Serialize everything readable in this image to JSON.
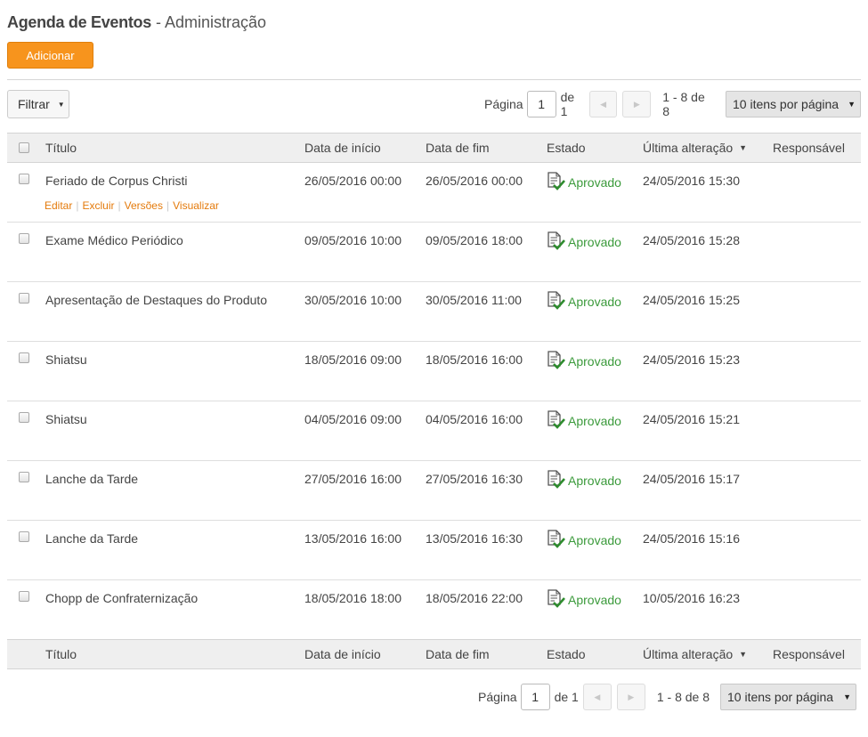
{
  "page": {
    "title": "Agenda de Eventos",
    "separator": "-",
    "subtitle": "Administração"
  },
  "toolbar": {
    "add_label": "Adicionar",
    "filter_label": "Filtrar"
  },
  "pager": {
    "page_label": "Página",
    "current_page": "1",
    "of_label": "de 1",
    "range": "1 - 8 de 8",
    "per_page": "10 itens por página",
    "prev_icon": "chevron-left-icon",
    "next_icon": "chevron-right-icon"
  },
  "columns": {
    "title": "Título",
    "start": "Data de início",
    "end": "Data de fim",
    "status": "Estado",
    "modified": "Última alteração",
    "owner": "Responsável"
  },
  "row_actions": {
    "edit": "Editar",
    "delete": "Excluir",
    "versions": "Versões",
    "view": "Visualizar"
  },
  "rows": [
    {
      "title": "Feriado de Corpus Christi",
      "start": "26/05/2016 00:00",
      "end": "26/05/2016 00:00",
      "status": "Aprovado",
      "modified": "24/05/2016 15:30",
      "owner": ""
    },
    {
      "title": "Exame Médico Periódico",
      "start": "09/05/2016 10:00",
      "end": "09/05/2016 18:00",
      "status": "Aprovado",
      "modified": "24/05/2016 15:28",
      "owner": ""
    },
    {
      "title": "Apresentação de Destaques do Produto",
      "start": "30/05/2016 10:00",
      "end": "30/05/2016 11:00",
      "status": "Aprovado",
      "modified": "24/05/2016 15:25",
      "owner": ""
    },
    {
      "title": "Shiatsu",
      "start": "18/05/2016 09:00",
      "end": "18/05/2016 16:00",
      "status": "Aprovado",
      "modified": "24/05/2016 15:23",
      "owner": ""
    },
    {
      "title": "Shiatsu",
      "start": "04/05/2016 09:00",
      "end": "04/05/2016 16:00",
      "status": "Aprovado",
      "modified": "24/05/2016 15:21",
      "owner": ""
    },
    {
      "title": "Lanche da Tarde",
      "start": "27/05/2016 16:00",
      "end": "27/05/2016 16:30",
      "status": "Aprovado",
      "modified": "24/05/2016 15:17",
      "owner": ""
    },
    {
      "title": "Lanche da Tarde",
      "start": "13/05/2016 16:00",
      "end": "13/05/2016 16:30",
      "status": "Aprovado",
      "modified": "24/05/2016 15:16",
      "owner": ""
    },
    {
      "title": "Chopp de Confraternização",
      "start": "18/05/2016 18:00",
      "end": "18/05/2016 22:00",
      "status": "Aprovado",
      "modified": "10/05/2016 16:23",
      "owner": ""
    }
  ],
  "colors": {
    "accent": "#f7941d",
    "status_approved": "#3b9a3b",
    "action_link": "#e47a0b",
    "header_bg": "#efefef"
  },
  "icons": {
    "status_icon": "document-check-icon",
    "sort_icon": "sort-descending-icon",
    "filter_caret": "caret-down-icon"
  }
}
